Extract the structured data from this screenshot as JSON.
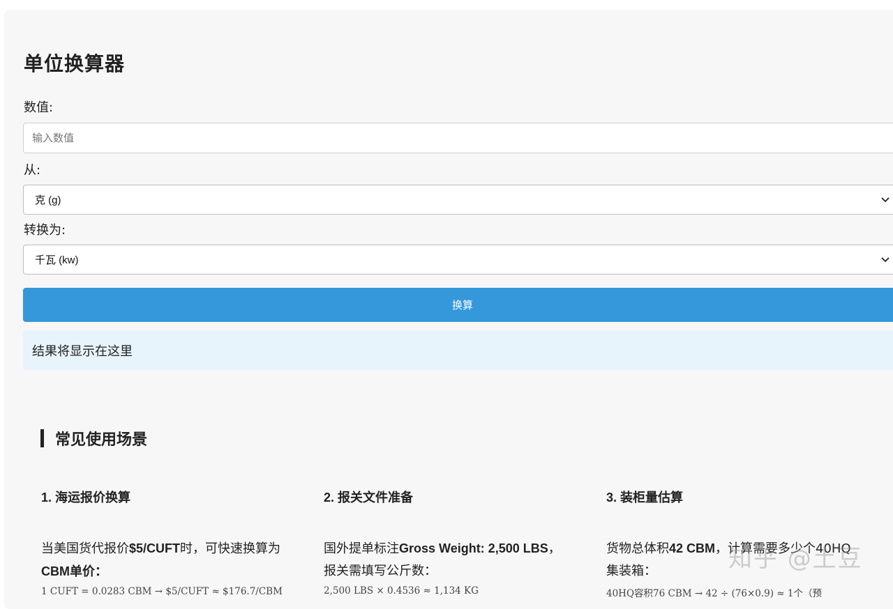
{
  "converter": {
    "title": "单位换算器",
    "value_label": "数值:",
    "value_placeholder": "输入数值",
    "value": "",
    "from_label": "从:",
    "from_selected": "克 (g)",
    "to_label": "转换为:",
    "to_selected": "千瓦 (kw)",
    "convert_button": "换算",
    "result_text": "结果将显示在这里"
  },
  "scenarios": {
    "title": "常见使用场景",
    "items": [
      {
        "heading": "1. 海运报价换算",
        "line1_a": "当美国货代报价",
        "line1_b": "$5/CUFT",
        "line1_c": "时，可快速换算为",
        "line2_b": "CBM单价",
        "line2_c": "：",
        "formula": "1 CUFT = 0.0283 CBM → $5/CUFT ≈ $176.7/CBM"
      },
      {
        "heading": "2. 报关文件准备",
        "line1_a": "国外提单标注",
        "line1_b": "Gross Weight: 2,500 LBS",
        "line1_c": "，",
        "line2_a": "报关需填写公斤数：",
        "formula": "2,500 LBS × 0.4536 ≈ 1,134 KG"
      },
      {
        "heading": "3. 装柜量估算",
        "line1_a": "货物总体积",
        "line1_b": "42 CBM",
        "line1_c": "，计算需要多少个40HQ",
        "line2_a": "集装箱：",
        "formula": "40HQ容积76 CBM → 42 ÷ (76×0.9) ≈ 1个（预"
      }
    ]
  },
  "watermark": "知乎 @土豆",
  "icons": {
    "select_arrow": "chevron-down-icon"
  },
  "colors": {
    "primary": "#3498db",
    "result_bg": "#e8f4fb"
  }
}
